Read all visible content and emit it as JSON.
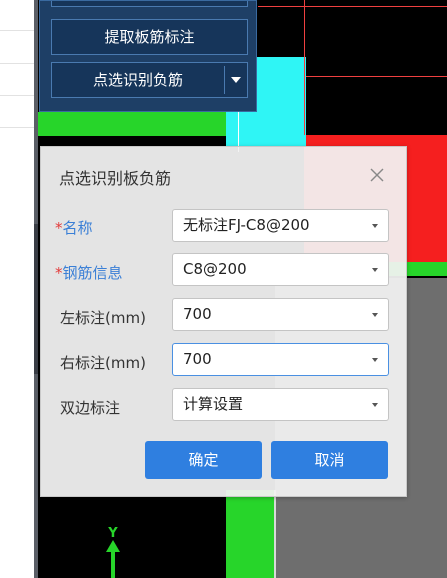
{
  "toolbar": {
    "extract_label": "提取板筋标注",
    "pick_label": "点选识别负筋"
  },
  "dialog": {
    "title": "点选识别板负筋",
    "fields": [
      {
        "required": "*",
        "label": "名称",
        "value": "无标注FJ-C8@200"
      },
      {
        "required": "*",
        "label": "钢筋信息",
        "value": "C8@200"
      },
      {
        "required": "",
        "label": "左标注(mm)",
        "value": "700"
      },
      {
        "required": "",
        "label": "右标注(mm)",
        "value": "700"
      },
      {
        "required": "",
        "label": "双边标注",
        "value": "计算设置"
      }
    ],
    "ok_label": "确定",
    "cancel_label": "取消"
  },
  "axis": {
    "y_label": "Y"
  },
  "colors": {
    "toolbar_bg": "#1e3f66",
    "canvas_bg": "#000000",
    "green": "#27d52a",
    "cyan": "#2ff5f5",
    "red": "#f51f1f",
    "gray": "#6e6e6e",
    "button_blue": "#2f7fe0",
    "required_red": "#e23b3b",
    "label_blue": "#3a7fd6"
  }
}
